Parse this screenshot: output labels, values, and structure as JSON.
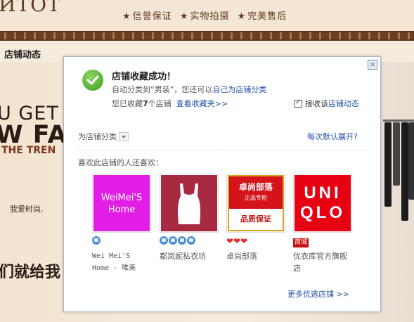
{
  "background": {
    "brand": "ИTOT",
    "slogans": [
      "信誉保证",
      "实物拍摄",
      "完美售后"
    ],
    "nav_label": "店铺动态",
    "banner_line1": "U GET",
    "banner_line2": "W FA",
    "banner_line3": "THE TREN",
    "banner_tagline": "我爱时尚,",
    "banner_bottom": "们就给我"
  },
  "dialog": {
    "close_label": "×",
    "title": "店铺收藏成功！",
    "auto_sort_prefix": "自动分类到“男装”，您还可以",
    "auto_sort_link": "自己为店铺分类",
    "collected_prefix": "您已收藏",
    "collected_count": "7",
    "collected_suffix": "个店铺",
    "view_favorites": "查看收藏夹>>",
    "subscribe_prefix": "接收该",
    "subscribe_link": "店铺动态",
    "category_label": "为店铺分类",
    "expand_link": "每次默认展开?",
    "also_like": "喜欢此店铺的人还喜欢：",
    "more_link": "更多优选店铺 >>",
    "shops": [
      {
        "logo_line1": "WeiMei'S",
        "logo_line2": "Home",
        "name": "Wei Mei'S Home - 唯美",
        "badge": "crowns",
        "badge_count": 1
      },
      {
        "name": "都岚妮私衣坊",
        "badge": "crowns",
        "badge_count": 4
      },
      {
        "logo_line1": "卓尚部落",
        "logo_line2": "正品专柜",
        "logo_line3": "品质保证",
        "name": "卓尚部落",
        "badge": "hearts",
        "badge_count": 3
      },
      {
        "logo_line1": "UNI",
        "logo_line2": "QLO",
        "name": "优衣库官方旗舰店",
        "badge": "mall",
        "badge_text": "商城"
      }
    ]
  }
}
